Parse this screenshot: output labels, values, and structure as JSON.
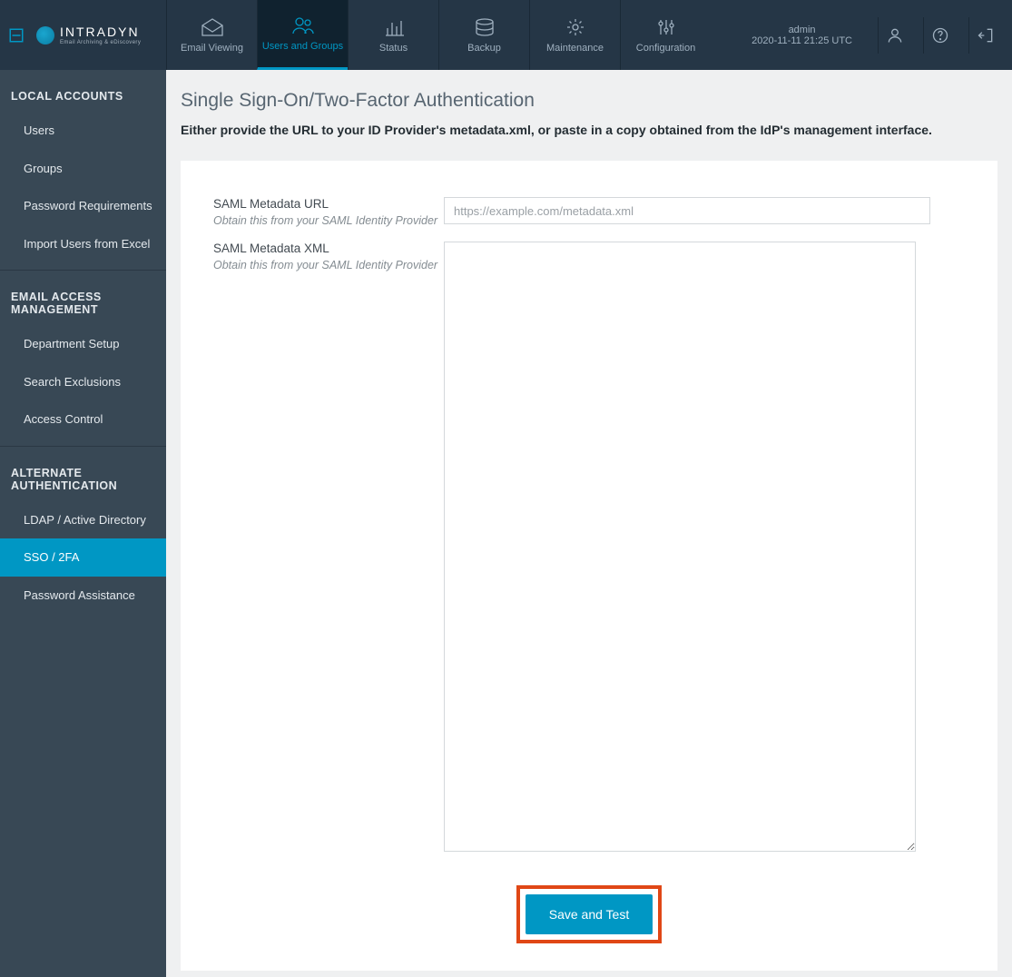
{
  "brand": {
    "name": "INTRADYN",
    "sub": "Email Archiving & eDiscovery"
  },
  "topnav": {
    "tabs": [
      {
        "id": "email-viewing",
        "label": "Email Viewing"
      },
      {
        "id": "users-groups",
        "label": "Users and Groups",
        "active": true
      },
      {
        "id": "status",
        "label": "Status"
      },
      {
        "id": "backup",
        "label": "Backup"
      },
      {
        "id": "maintenance",
        "label": "Maintenance"
      },
      {
        "id": "configuration",
        "label": "Configuration"
      }
    ],
    "user": {
      "name": "admin",
      "timestamp": "2020-11-11 21:25 UTC"
    }
  },
  "sidebar": {
    "sections": [
      {
        "title": "LOCAL ACCOUNTS",
        "items": [
          {
            "label": "Users"
          },
          {
            "label": "Groups"
          },
          {
            "label": "Password Requirements"
          },
          {
            "label": "Import Users from Excel"
          }
        ]
      },
      {
        "title": "EMAIL ACCESS MANAGEMENT",
        "items": [
          {
            "label": "Department Setup"
          },
          {
            "label": "Search Exclusions"
          },
          {
            "label": "Access Control"
          }
        ]
      },
      {
        "title": "ALTERNATE AUTHENTICATION",
        "items": [
          {
            "label": "LDAP / Active Directory"
          },
          {
            "label": "SSO / 2FA",
            "active": true
          },
          {
            "label": "Password Assistance"
          }
        ]
      }
    ]
  },
  "page": {
    "title": "Single Sign-On/Two-Factor Authentication",
    "description": "Either provide the URL to your ID Provider's metadata.xml, or paste in a copy obtained from the IdP's management interface.",
    "form": {
      "url_label": "SAML Metadata URL",
      "url_hint": "Obtain this from your SAML Identity Provider",
      "url_placeholder": "https://example.com/metadata.xml",
      "xml_label": "SAML Metadata XML",
      "xml_hint": "Obtain this from your SAML Identity Provider",
      "submit_label": "Save and Test"
    }
  }
}
